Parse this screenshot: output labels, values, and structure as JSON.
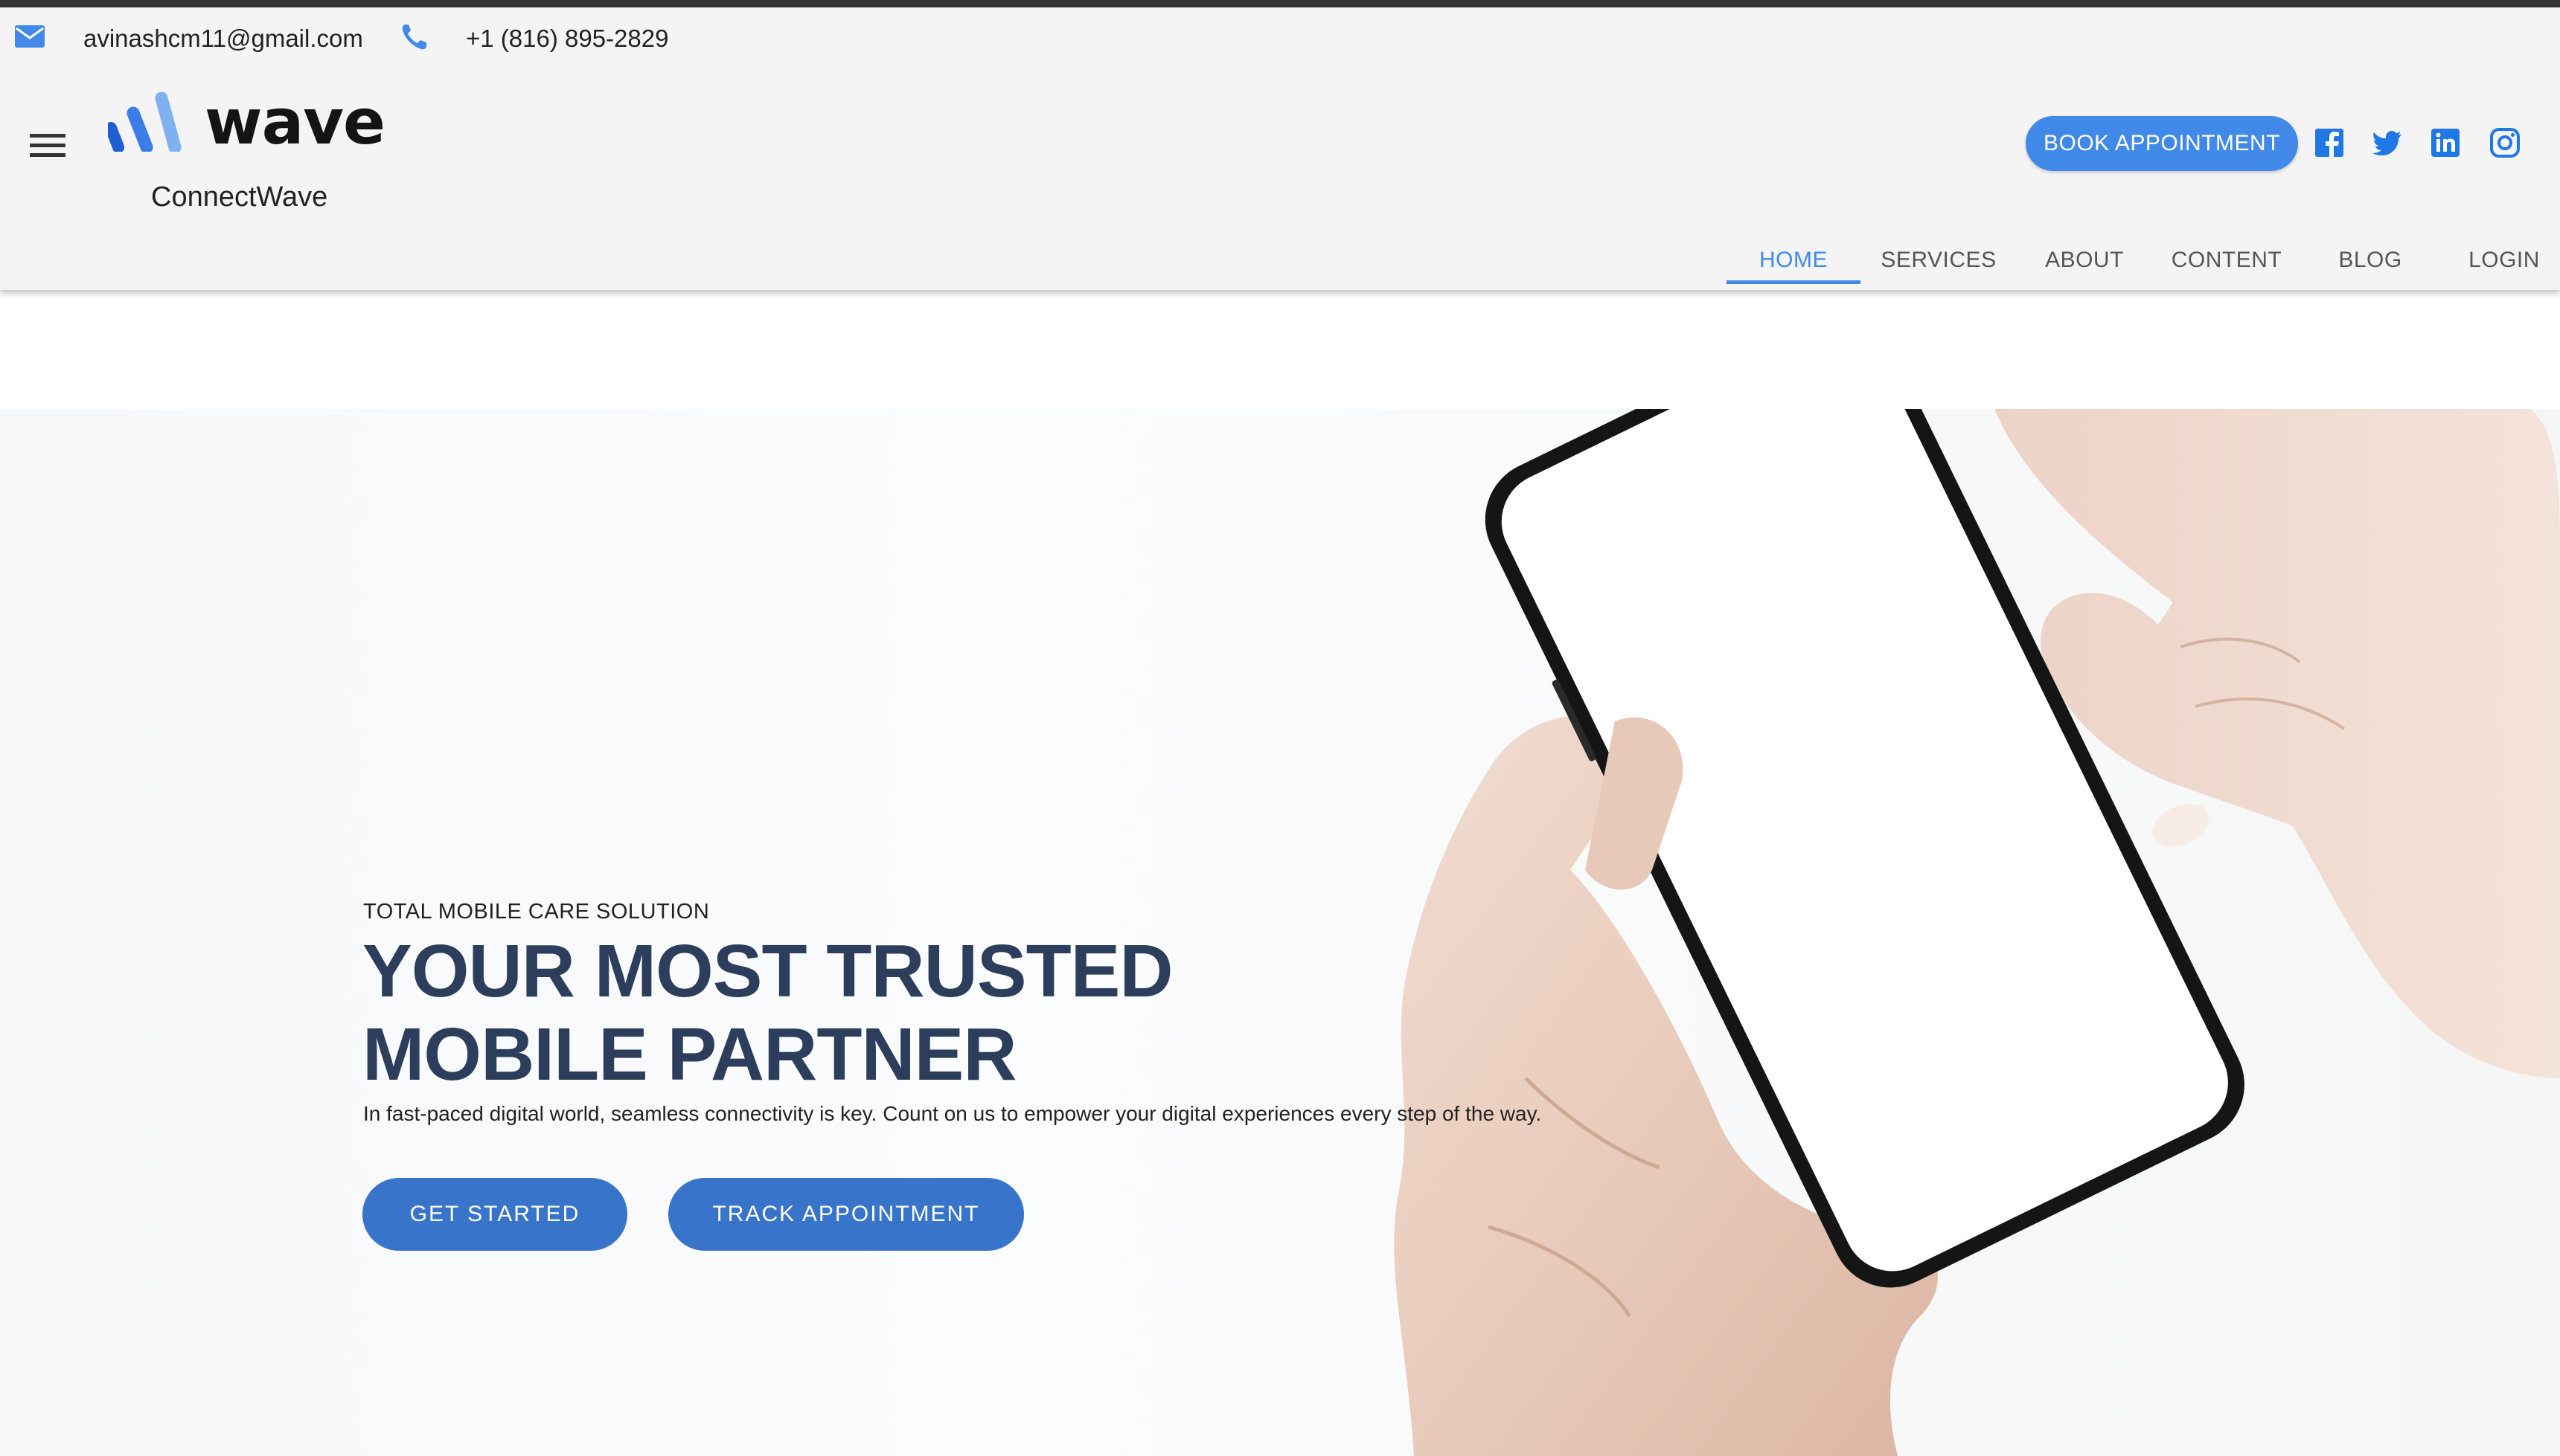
{
  "contact": {
    "email": "avinashcm11@gmail.com",
    "phone": "+1 (816) 895-2829"
  },
  "brand": {
    "logo_text": "wave",
    "name": "ConnectWave"
  },
  "header": {
    "book_label": "BOOK APPOINTMENT",
    "social_icons": [
      "facebook-icon",
      "twitter-icon",
      "linkedin-icon",
      "instagram-icon"
    ]
  },
  "nav": {
    "items": [
      {
        "label": "HOME",
        "active": true
      },
      {
        "label": "SERVICES",
        "active": false
      },
      {
        "label": "ABOUT",
        "active": false
      },
      {
        "label": "CONTENT",
        "active": false
      },
      {
        "label": "BLOG",
        "active": false
      },
      {
        "label": "LOGIN",
        "active": false
      }
    ]
  },
  "hero": {
    "kicker": "TOTAL MOBILE CARE SOLUTION",
    "headline_line1": "YOUR MOST TRUSTED",
    "headline_line2": "MOBILE PARTNER",
    "subtext": "In fast-paced digital world, seamless connectivity is key. Count on us to empower your digital experiences every step of the way.",
    "primary_cta": "GET STARTED",
    "secondary_cta": "TRACK APPOINTMENT"
  },
  "colors": {
    "accent": "#4189e8",
    "cta": "#3874c9",
    "headline": "#2c3e5c"
  }
}
